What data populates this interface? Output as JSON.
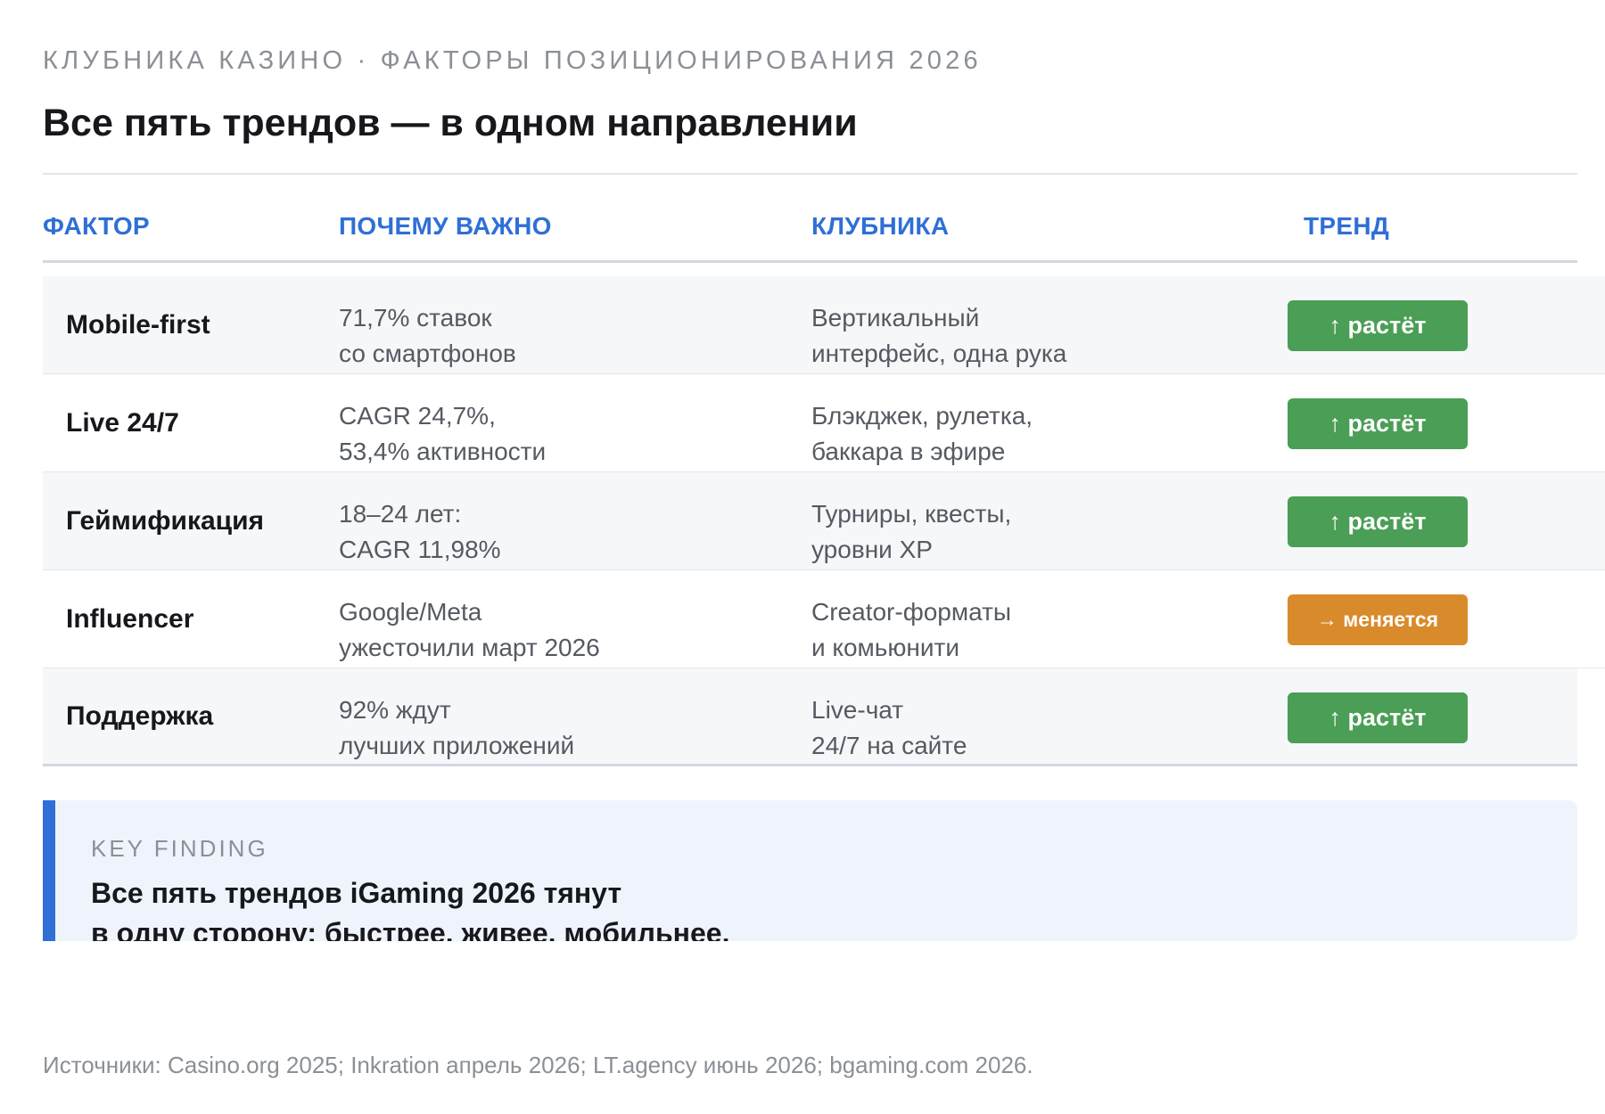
{
  "header": {
    "eyebrow": "КЛУБНИКА КАЗИНО · ФАКТОРЫ ПОЗИЦИОНИРОВАНИЯ 2026",
    "title": "Все пять трендов — в одном направлении"
  },
  "table": {
    "headers": {
      "factor": "ФАКТОР",
      "why": "ПОЧЕМУ ВАЖНО",
      "klubnika": "КЛУБНИКА",
      "trend": "ТРЕНД"
    },
    "rows": [
      {
        "factor": "Mobile-first",
        "why": [
          "71,7% ставок",
          "со смартфонов"
        ],
        "klubnika": [
          "Вертикальный",
          "интерфейс, одна рука"
        ],
        "trend": "↑ растёт",
        "trend_status": "up"
      },
      {
        "factor": "Live 24/7",
        "why": [
          "CAGR 24,7%,",
          "53,4% активности"
        ],
        "klubnika": [
          "Блэкджек, рулетка,",
          "баккара в эфире"
        ],
        "trend": "↑ растёт",
        "trend_status": "up"
      },
      {
        "factor": "Геймификация",
        "why": [
          "18–24 лет:",
          "CAGR 11,98%"
        ],
        "klubnika": [
          "Турниры, квесты,",
          "уровни XP"
        ],
        "trend": "↑ растёт",
        "trend_status": "up"
      },
      {
        "factor": "Influencer",
        "why": [
          "Google/Meta",
          "ужесточили март 2026"
        ],
        "klubnika": [
          "Creator-форматы",
          "и комьюнити"
        ],
        "trend": "→ меняется",
        "trend_status": "change"
      },
      {
        "factor": "Поддержка",
        "why": [
          "92% ждут",
          "лучших приложений"
        ],
        "klubnika": [
          "Live-чат",
          "24/7 на сайте"
        ],
        "trend": "↑ растёт",
        "trend_status": "up"
      }
    ]
  },
  "finding": {
    "label": "KEY FINDING",
    "lines": [
      "Все пять трендов iGaming 2026 тянут",
      "в одну сторону: быстрее, живее, мобильнее."
    ]
  },
  "footer": {
    "sources": "Источники: Casino.org 2025; Inkration апрель 2026; LT.agency июнь 2026; bgaming.com 2026."
  },
  "colors": {
    "accent": "#2f6fd6",
    "trend_up": "#4a9e55",
    "trend_change": "#d98a2b",
    "finding_bg": "#eff4fc"
  }
}
